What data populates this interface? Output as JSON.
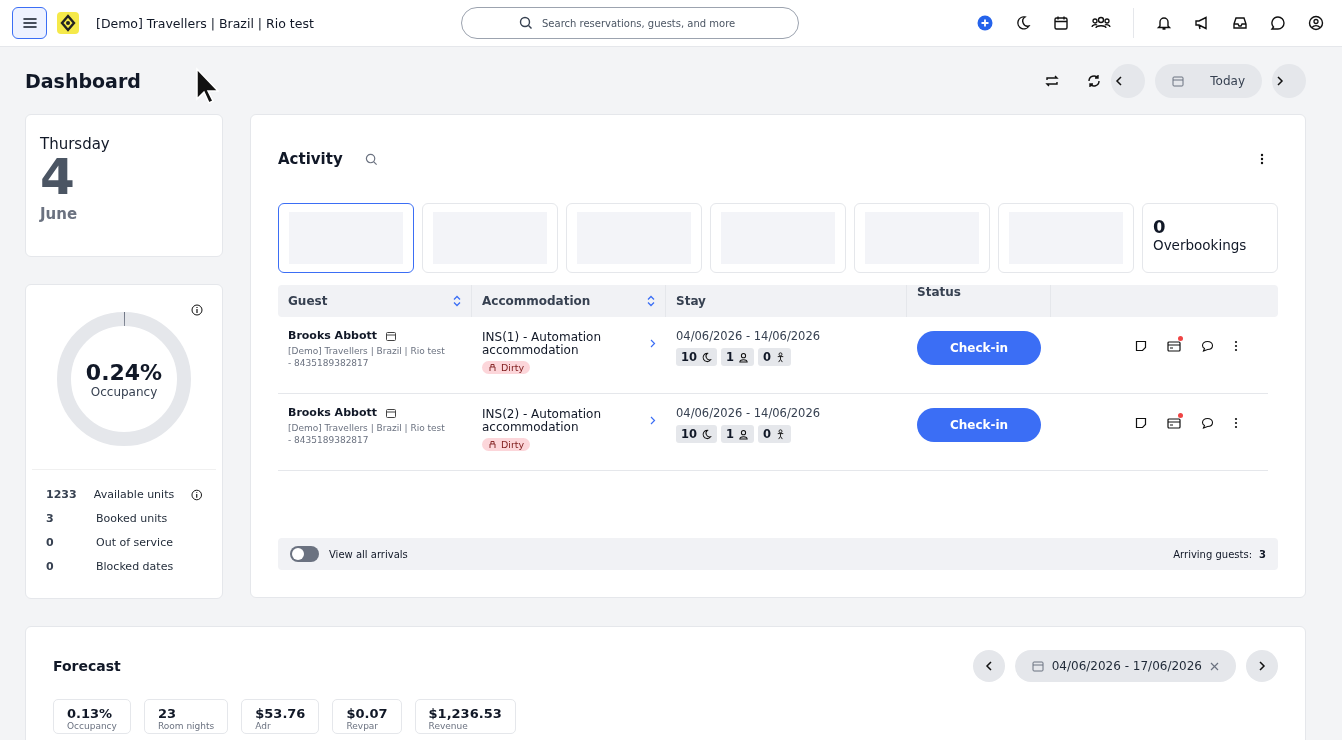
{
  "topbar": {
    "property": "[Demo] Travellers | Brazil | Rio test",
    "search": {
      "placeholder": "Search reservations, guests, and more"
    }
  },
  "page": {
    "title": "Dashboard",
    "today_button": "Today"
  },
  "date_card": {
    "weekday": "Thursday",
    "day": "4",
    "month": "June"
  },
  "occupancy": {
    "level": 0.0024,
    "value": "0.24%",
    "label": "Occupancy",
    "stats": [
      {
        "value": "1233",
        "label": "Available units",
        "info": true
      },
      {
        "value": "3",
        "label": "Booked units",
        "info": false
      },
      {
        "value": "0",
        "label": "Out of service",
        "info": false
      },
      {
        "value": "0",
        "label": "Blocked dates",
        "info": false
      }
    ]
  },
  "activity": {
    "title": "Activity",
    "tiles": [
      {
        "kind": "loading",
        "selected": true
      },
      {
        "kind": "loading",
        "selected": false
      },
      {
        "kind": "loading",
        "selected": false
      },
      {
        "kind": "loading",
        "selected": false
      },
      {
        "kind": "loading",
        "selected": false
      },
      {
        "kind": "loading",
        "selected": false
      },
      {
        "kind": "stat",
        "selected": false,
        "value": "0",
        "label": "Overbookings"
      }
    ],
    "columns": [
      {
        "label": "Guest",
        "sortable": true
      },
      {
        "label": "Accommodation",
        "sortable": true
      },
      {
        "label": "Stay",
        "sortable": false
      },
      {
        "label": "Status",
        "sortable": false
      }
    ],
    "rows": [
      {
        "guest": "Brooks Abbott",
        "property": "[Demo] Travellers | Brazil | Rio test",
        "code": "- 8435189382817",
        "accommodation": "INS(1) - Automation accommodation",
        "housekeeping": "Dirty",
        "dates": "04/06/2026 - 14/06/2026",
        "nights": "10",
        "adults": "1",
        "children": "0",
        "action": "Check-in",
        "payment_alert": true
      },
      {
        "guest": "Brooks Abbott",
        "property": "[Demo] Travellers | Brazil | Rio test",
        "code": "- 8435189382817",
        "accommodation": "INS(2) - Automation accommodation",
        "housekeeping": "Dirty",
        "dates": "04/06/2026 - 14/06/2026",
        "nights": "10",
        "adults": "1",
        "children": "0",
        "action": "Check-in",
        "payment_alert": true
      }
    ],
    "toggle": {
      "label": "View all arrivals",
      "on": false
    },
    "arriving_label": "Arriving guests:",
    "arriving_count": "3"
  },
  "forecast": {
    "title": "Forecast",
    "range": "04/06/2026 - 17/06/2026",
    "stats": [
      {
        "value": "0.13%",
        "label": "Occupancy"
      },
      {
        "value": "23",
        "label": "Room nights"
      },
      {
        "value": "$53.76",
        "label": "Adr"
      },
      {
        "value": "$0.07",
        "label": "Revpar"
      },
      {
        "value": "$1,236.53",
        "label": "Revenue"
      }
    ]
  }
}
